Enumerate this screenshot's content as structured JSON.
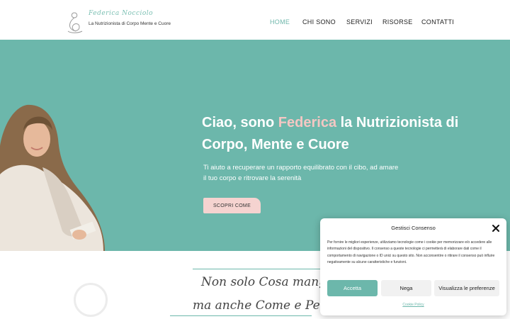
{
  "header": {
    "logo_script": "Federica Nocciolo",
    "logo_tagline": "La Nutrizionista di Corpo Mente e Cuore",
    "nav": [
      {
        "label": "HOME",
        "active": true
      },
      {
        "label": "CHI SONO",
        "active": false
      },
      {
        "label": "SERVIZI",
        "active": false
      },
      {
        "label": "RISORSE",
        "active": false
      },
      {
        "label": "CONTATTI",
        "active": false
      }
    ]
  },
  "hero": {
    "title_before": "Ciao, sono ",
    "title_highlight": "Federica",
    "title_after": " la Nutrizionista di Corpo, Mente e Cuore",
    "subtitle": "Ti aiuto a recuperare un rapporto equilibrato con il cibo, ad amare il tuo corpo e ritrovare la serenità",
    "cta_label": "SCOPRI COME"
  },
  "tagline": {
    "l1_a": "Non solo ",
    "l1_b": "Cosa",
    "l1_c": " mangi",
    "l2_a": "ma anche ",
    "l2_b": "Come",
    "l2_c": " e ",
    "l2_d": "Perch"
  },
  "consent": {
    "title": "Gestisci Consenso",
    "text": "Per fornire le migliori esperienze, utilizziamo tecnologie come i cookie per memorizzare e/o accedere alle informazioni del dispositivo. Il consenso a queste tecnologie ci permetterà di elaborare dati come il comportamento di navigazione o ID unici su questo sito. Non acconsentire o ritirare il consenso può influire negativamente su alcune caratteristiche e funzioni.",
    "accept_label": "Accetta",
    "deny_label": "Nega",
    "prefs_label": "Visualizza le preferenze",
    "policy_link": "Cookie Policy"
  },
  "colors": {
    "teal": "#6cb7ab",
    "pink": "#f4c7c3",
    "button_pink": "#f5d3d0"
  }
}
